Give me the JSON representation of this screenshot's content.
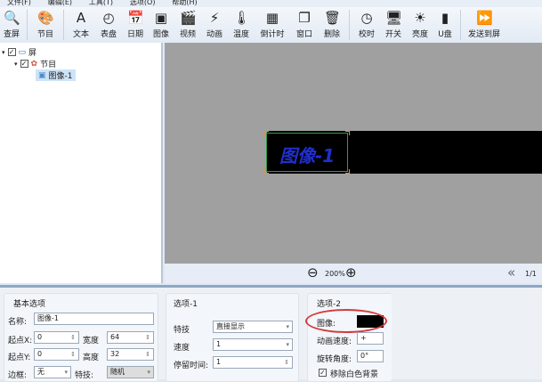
{
  "menu": [
    "文件(F)",
    "编辑(E)",
    "工具(T)",
    "选项(O)",
    "帮助(H)"
  ],
  "toolbar": [
    {
      "label": "查屏",
      "icon": "search-icon",
      "glyph": "🔍"
    },
    {
      "label": "节目",
      "icon": "program-icon",
      "glyph": "🎨"
    },
    {
      "label": "文本",
      "icon": "text-icon",
      "glyph": "A"
    },
    {
      "label": "表盘",
      "icon": "clock-dial-icon",
      "glyph": "◴"
    },
    {
      "label": "日期",
      "icon": "calendar-icon",
      "glyph": "📅"
    },
    {
      "label": "图像",
      "icon": "image-icon",
      "glyph": "▣"
    },
    {
      "label": "视频",
      "icon": "video-icon",
      "glyph": "🎬"
    },
    {
      "label": "动画",
      "icon": "animation-icon",
      "glyph": "⚡"
    },
    {
      "label": "温度",
      "icon": "thermometer-icon",
      "glyph": "🌡"
    },
    {
      "label": "倒计时",
      "icon": "countdown-icon",
      "glyph": "▦"
    },
    {
      "label": "窗口",
      "icon": "window-icon",
      "glyph": "❐"
    },
    {
      "label": "删除",
      "icon": "trash-icon",
      "glyph": "🗑"
    },
    {
      "label": "校时",
      "icon": "time-sync-icon",
      "glyph": "◷"
    },
    {
      "label": "开关",
      "icon": "monitor-icon",
      "glyph": "🖥"
    },
    {
      "label": "亮度",
      "icon": "brightness-icon",
      "glyph": "☀"
    },
    {
      "label": "U盘",
      "icon": "usb-icon",
      "glyph": "▮"
    },
    {
      "label": "发送到屏",
      "icon": "send-icon",
      "glyph": "⏩"
    }
  ],
  "tree": {
    "screen": "屏",
    "program": "节目",
    "image": "图像-1"
  },
  "canvas": {
    "item_text": "图像-1",
    "zoom": "200%",
    "page": "1/1"
  },
  "basic": {
    "title": "基本选项",
    "name_label": "名称:",
    "name": "图像-1",
    "x_label": "起点X:",
    "x": "0",
    "w_label": "宽度",
    "w": "64",
    "y_label": "起点Y:",
    "y": "0",
    "h_label": "高度",
    "h": "32",
    "border_label": "边框:",
    "border": "无",
    "effect_label": "特技:",
    "effect": "随机"
  },
  "opt1": {
    "title": "选项-1",
    "effect_label": "特技",
    "effect": "直接显示",
    "speed_label": "速度",
    "speed": "1",
    "stay_label": "停留时间:",
    "stay": "1"
  },
  "opt2": {
    "title": "选项-2",
    "image_label": "图像:",
    "anim_speed_label": "动画速度:",
    "anim_speed": "+",
    "rotate_label": "旋转角度:",
    "rotate": "0°",
    "remove_white": "移除白色背景",
    "remove_white_checked": true
  },
  "colors": {
    "canvas": "#a0a0a0",
    "item_text": "#1f2fd0",
    "annotation": "#d23c3c"
  }
}
